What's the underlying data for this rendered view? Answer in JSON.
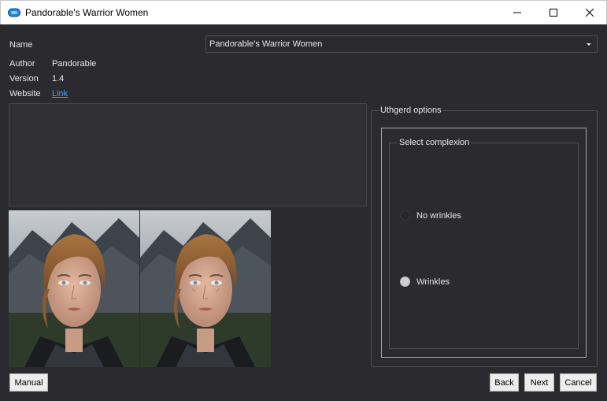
{
  "window": {
    "title": "Pandorable's Warrior Women",
    "icons": [
      "app-icon",
      "minimize-icon",
      "maximize-icon",
      "close-icon"
    ]
  },
  "info": {
    "name_label": "Name",
    "author_label": "Author",
    "author_value": "Pandorable",
    "version_label": "Version",
    "version_value": "1.4",
    "website_label": "Website",
    "website_link": "Link"
  },
  "name_select": {
    "selected": "Pandorable's Warrior Women"
  },
  "options_group": {
    "title": "Uthgerd options",
    "complexion_group": {
      "title": "Select complexion",
      "options": [
        {
          "label": "No wrinkles",
          "checked": false
        },
        {
          "label": "Wrinkles",
          "checked": true
        }
      ]
    }
  },
  "buttons": {
    "manual": "Manual",
    "back": "Back",
    "next": "Next",
    "cancel": "Cancel"
  },
  "colors": {
    "background": "#2b2b2f",
    "link": "#4a9eff",
    "text": "#e6e6e6"
  }
}
